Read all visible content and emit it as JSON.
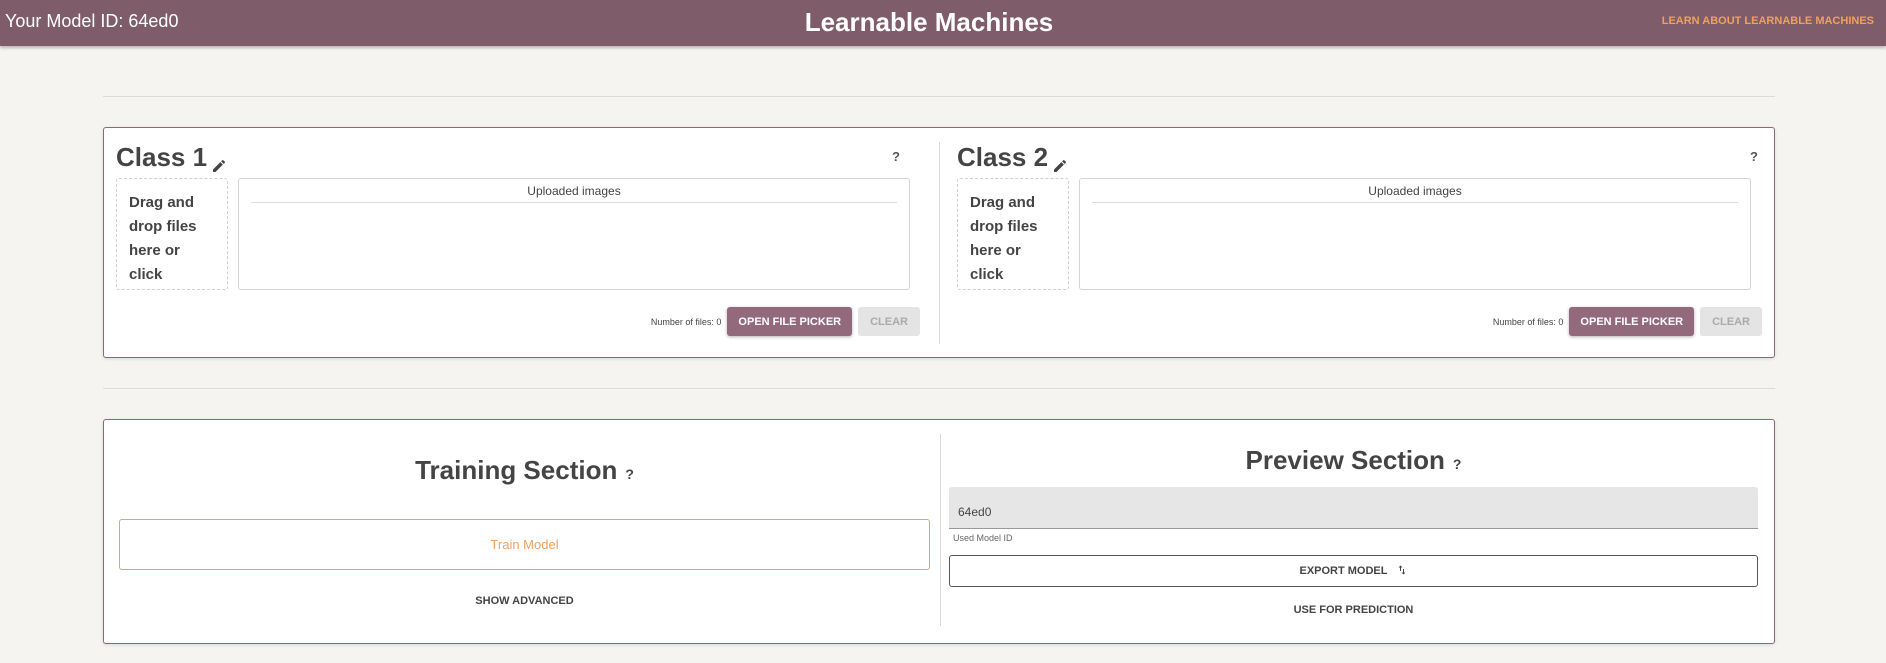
{
  "header": {
    "model_id_label": "Your Model ID: 64ed0",
    "title": "Learnable Machines",
    "learn_link": "LEARN ABOUT LEARNABLE MACHINES"
  },
  "classes": [
    {
      "title": "Class 1",
      "help": "?",
      "dropzone_text": "Drag and drop files here or click",
      "uploaded_label": "Uploaded images",
      "file_count": "Number of files: 0",
      "picker_label": "OPEN FILE PICKER",
      "clear_label": "CLEAR"
    },
    {
      "title": "Class 2",
      "help": "?",
      "dropzone_text": "Drag and drop files here or click",
      "uploaded_label": "Uploaded images",
      "file_count": "Number of files: 0",
      "picker_label": "OPEN FILE PICKER",
      "clear_label": "CLEAR"
    }
  ],
  "training": {
    "title": "Training Section",
    "help": "?",
    "train_label": "Train Model",
    "advanced_label": "SHOW ADVANCED"
  },
  "preview": {
    "title": "Preview Section",
    "help": "?",
    "model_id_value": "64ed0",
    "model_id_helper": "Used Model ID",
    "export_label": "EXPORT MODEL",
    "export_icon": "swap-vert-icon",
    "predict_label": "USE FOR PREDICTION"
  },
  "colors": {
    "header_bg": "#7e5c69",
    "accent_orange": "#f0a060",
    "picker_button": "#93697c",
    "page_bg": "#f5f4f0"
  }
}
